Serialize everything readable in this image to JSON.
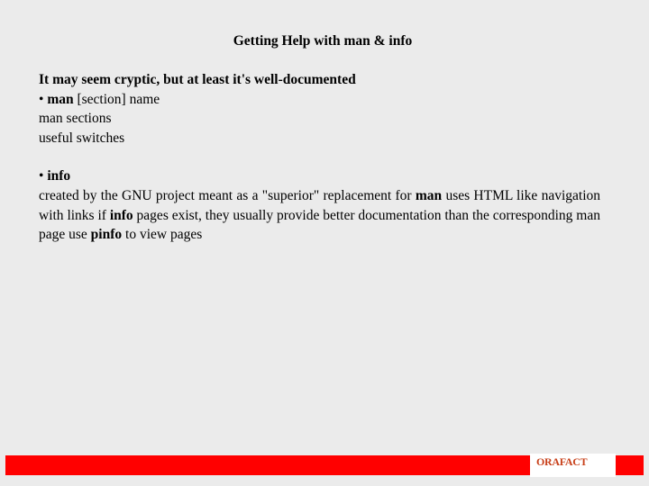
{
  "slide": {
    "title": "Getting Help with man & info"
  },
  "content": {
    "intro": "It may seem cryptic, but at least it's well-documented",
    "man_bullet": {
      "bullet": "• ",
      "command": "man",
      "args": " [section] name"
    },
    "man_lines": [
      "man sections",
      "useful switches"
    ],
    "info_bullet": {
      "bullet": "• ",
      "command": "info"
    },
    "info_paragraph": {
      "part1": "created by the GNU project meant as a \"superior\" replacement for ",
      "bold1": "man",
      "part2": " uses HTML like navigation with links if ",
      "bold2": "info",
      "part3": " pages exist, they usually provide better documentation than the corresponding man page use ",
      "bold3": "pinfo",
      "part4": " to view pages"
    }
  },
  "footer": {
    "logo_text": "ORAFACT",
    "colors": {
      "bar": "#ff0000",
      "logo_box": "#ffffff",
      "logo_text": "#c8401a"
    }
  }
}
